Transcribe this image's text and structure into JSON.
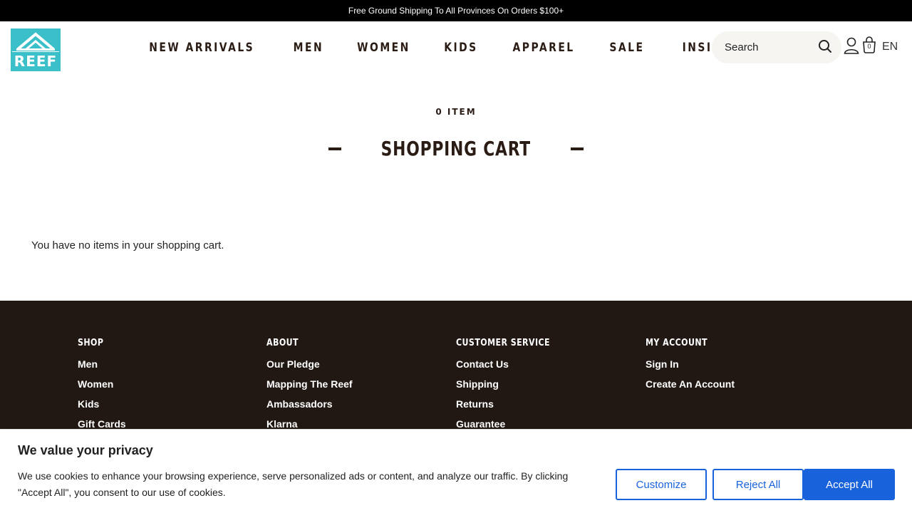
{
  "promo": {
    "text": "Free Ground Shipping To All Provinces On Orders $100+"
  },
  "header": {
    "logo_text": "REEF",
    "nav": [
      "NEW ARRIVALS",
      "MEN",
      "WOMEN",
      "KIDS",
      "APPAREL",
      "SALE",
      "INSIDE REEF"
    ],
    "search_placeholder": "Search",
    "bag_count": "0",
    "language": "EN"
  },
  "cart": {
    "count_label": "0 ITEM",
    "title": "SHOPPING CART",
    "empty_message": "You have no items in your shopping cart."
  },
  "footer": {
    "columns": [
      {
        "heading": "SHOP",
        "links": [
          "Men",
          "Women",
          "Kids",
          "Gift Cards"
        ]
      },
      {
        "heading": "ABOUT",
        "links": [
          "Our Pledge",
          "Mapping The Reef",
          "Ambassadors",
          "Klarna"
        ]
      },
      {
        "heading": "CUSTOMER SERVICE",
        "links": [
          "Contact Us",
          "Shipping",
          "Returns",
          "Guarantee"
        ]
      },
      {
        "heading": "MY ACCOUNT",
        "links": [
          "Sign In",
          "Create An Account"
        ]
      }
    ]
  },
  "cookie": {
    "title": "We value your privacy",
    "text": "We use cookies to enhance your browsing experience, serve personalized ads or content, and analyze our traffic. By clicking \"Accept All\", you consent to our use of cookies.",
    "customize": "Customize",
    "reject": "Reject All",
    "accept": "Accept All"
  },
  "colors": {
    "brand_teal": "#3bbfc9",
    "footer_bg": "#221813",
    "accent_blue": "#1863dc"
  }
}
